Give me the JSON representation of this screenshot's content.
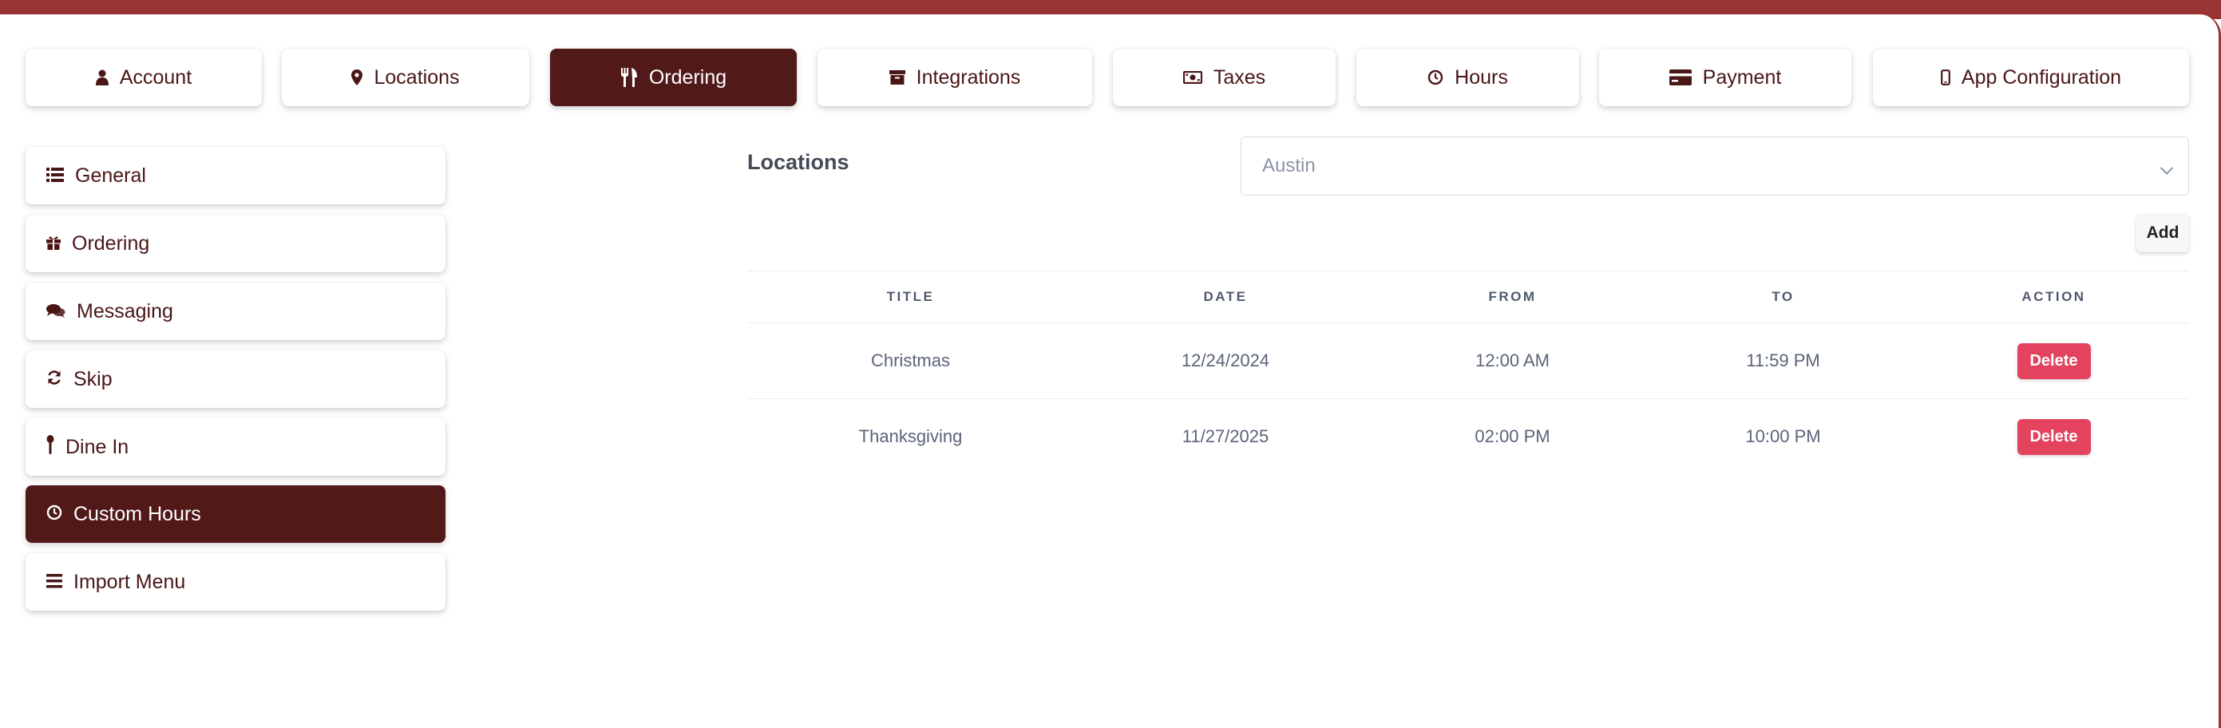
{
  "top_tabs": [
    {
      "label": "Account",
      "icon": "user-icon"
    },
    {
      "label": "Locations",
      "icon": "map-pin-icon"
    },
    {
      "label": "Ordering",
      "icon": "utensils-icon",
      "active": true
    },
    {
      "label": "Integrations",
      "icon": "archive-icon"
    },
    {
      "label": "Taxes",
      "icon": "money-bill-icon"
    },
    {
      "label": "Hours",
      "icon": "clock-icon"
    },
    {
      "label": "Payment",
      "icon": "credit-card-icon"
    },
    {
      "label": "App Configuration",
      "icon": "mobile-icon"
    }
  ],
  "sidebar": {
    "items": [
      {
        "label": "General",
        "icon": "list-icon"
      },
      {
        "label": "Ordering",
        "icon": "gift-icon"
      },
      {
        "label": "Messaging",
        "icon": "comments-icon"
      },
      {
        "label": "Skip",
        "icon": "refresh-icon"
      },
      {
        "label": "Dine In",
        "icon": "spoon-icon"
      },
      {
        "label": "Custom Hours",
        "icon": "clock-icon",
        "active": true
      },
      {
        "label": "Import Menu",
        "icon": "bars-icon"
      }
    ]
  },
  "main": {
    "locations_label": "Locations",
    "location_select": {
      "selected": "Austin"
    },
    "add_label": "Add",
    "table": {
      "headers": [
        "TITLE",
        "DATE",
        "FROM",
        "TO",
        "ACTION"
      ],
      "rows": [
        {
          "title": "Christmas",
          "date": "12/24/2024",
          "from": "12:00 AM",
          "to": "11:59 PM",
          "action": "Delete"
        },
        {
          "title": "Thanksgiving",
          "date": "11/27/2025",
          "from": "02:00 PM",
          "to": "10:00 PM",
          "action": "Delete"
        }
      ]
    }
  },
  "colors": {
    "brand": "#521919",
    "topbar": "#9a3434",
    "delete": "#e3435f",
    "text": "#4a1616"
  }
}
